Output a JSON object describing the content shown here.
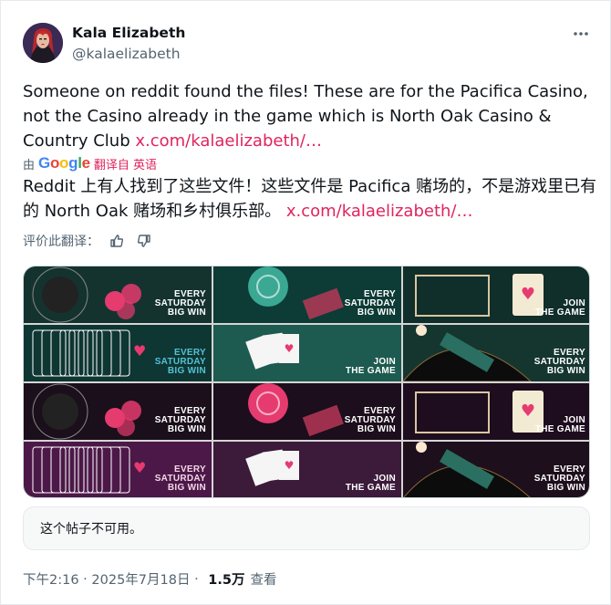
{
  "author": {
    "name": "Kala Elizabeth",
    "handle": "@kalaelizabeth"
  },
  "tweet": {
    "text": "Someone on reddit found the files! These are for the Pacifica Casino, not the Casino already in the game which is North Oak Casino & Country Club ",
    "link": "x.com/kalaelizabeth/…"
  },
  "translation": {
    "by_prefix": "由",
    "google": [
      "G",
      "o",
      "o",
      "g",
      "l",
      "e"
    ],
    "action": "翻译自 英语",
    "text": "Reddit 上有人找到了这些文件！这些文件是 Pacifica 赌场的，不是游戏里已有的 North Oak 赌场和乡村俱乐部。 ",
    "link": "x.com/kalaelizabeth/…",
    "rate_label": "评价此翻译："
  },
  "media": {
    "tiles": [
      {
        "text": "EVERY\nSATURDAY\nBIG WIN",
        "palette": "teal"
      },
      {
        "text": "EVERY\nSATURDAY\nBIG WIN",
        "palette": "teal-chips"
      },
      {
        "text": "JOIN\nTHE GAME",
        "palette": "teal-card"
      },
      {
        "text": "EVERY\nSATURDAY\nBIG WIN",
        "palette": "teal-cards"
      },
      {
        "text": "JOIN\nTHE GAME",
        "palette": "teal-hand"
      },
      {
        "text": "EVERY\nSATURDAY\nBIG WIN",
        "palette": "teal-table"
      },
      {
        "text": "EVERY\nSATURDAY\nBIG WIN",
        "palette": "magenta"
      },
      {
        "text": "EVERY\nSATURDAY\nBIG WIN",
        "palette": "magenta-chips"
      },
      {
        "text": "JOIN\nTHE GAME",
        "palette": "magenta-card"
      },
      {
        "text": "EVERY\nSATURDAY\nBIG WIN",
        "palette": "purple-cards"
      },
      {
        "text": "JOIN\nTHE GAME",
        "palette": "purple-hand"
      },
      {
        "text": "EVERY\nSATURDAY\nBIG WIN",
        "palette": "purple-table"
      }
    ]
  },
  "unavailable_notice": "这个帖子不可用。",
  "meta": {
    "time": "下午2:16",
    "separator": " · ",
    "date": "2025年7月18日",
    "views": "1.5万",
    "views_label": "查看"
  },
  "colors": {
    "link": "#e0245e",
    "secondary_text": "#536471"
  }
}
